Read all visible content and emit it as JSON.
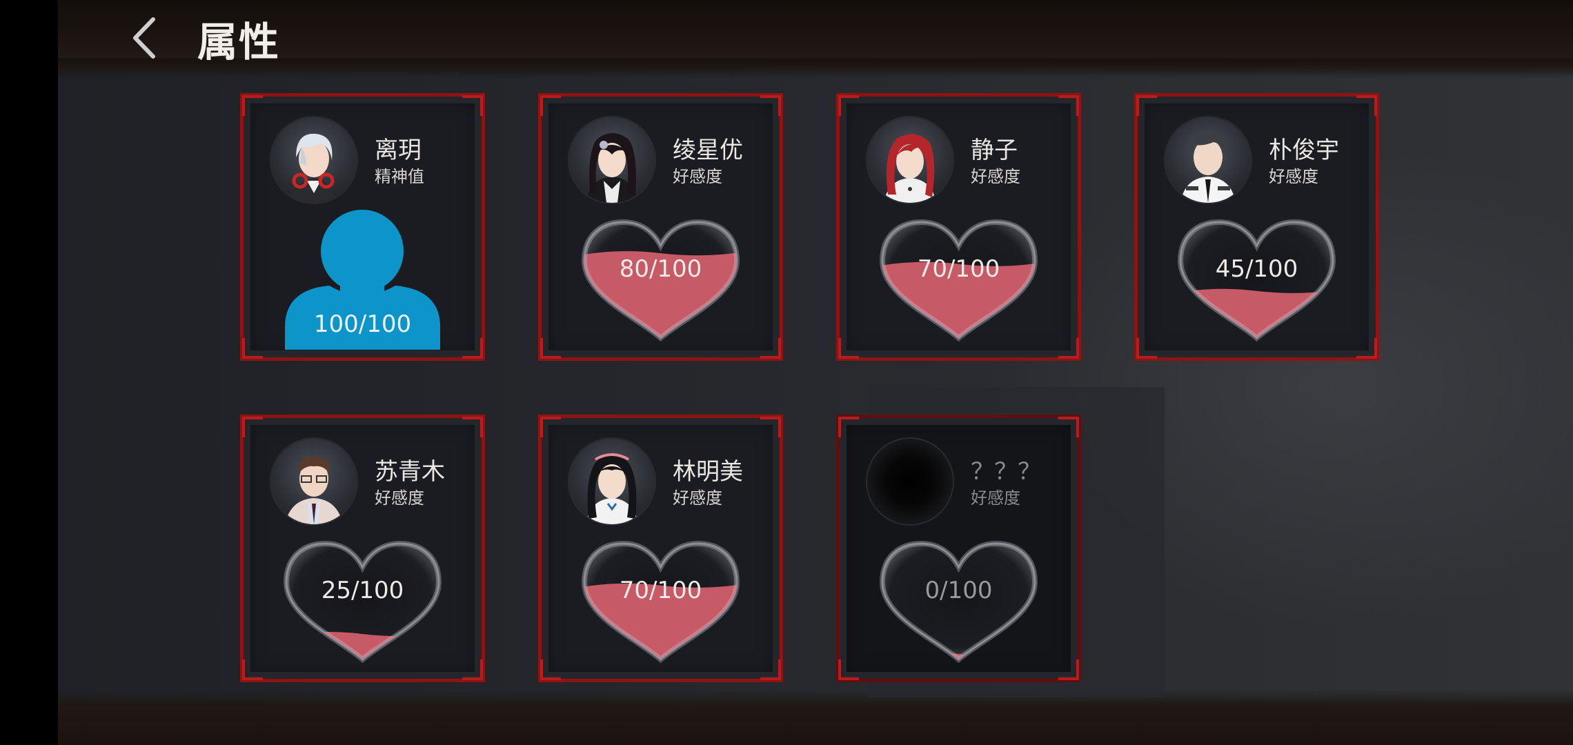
{
  "header": {
    "title": "属性"
  },
  "characters": [
    {
      "name": "离玥",
      "stat": "精神值",
      "value": 100,
      "max": 100,
      "display": "100/100",
      "gauge": "person",
      "color": "#0d94c8"
    },
    {
      "name": "绫星优",
      "stat": "好感度",
      "value": 80,
      "max": 100,
      "display": "80/100",
      "gauge": "heart",
      "color": "#c65a67"
    },
    {
      "name": "静子",
      "stat": "好感度",
      "value": 70,
      "max": 100,
      "display": "70/100",
      "gauge": "heart",
      "color": "#c65a67"
    },
    {
      "name": "朴俊宇",
      "stat": "好感度",
      "value": 45,
      "max": 100,
      "display": "45/100",
      "gauge": "heart",
      "color": "#c65a67"
    },
    {
      "name": "苏青木",
      "stat": "好感度",
      "value": 25,
      "max": 100,
      "display": "25/100",
      "gauge": "heart",
      "color": "#c65a67"
    },
    {
      "name": "林明美",
      "stat": "好感度",
      "value": 70,
      "max": 100,
      "display": "70/100",
      "gauge": "heart",
      "color": "#c65a67"
    },
    {
      "name": "？？？",
      "stat": "好感度",
      "value": 0,
      "max": 100,
      "display": "0/100",
      "gauge": "heart",
      "color": "#c65a67",
      "locked": true
    }
  ]
}
